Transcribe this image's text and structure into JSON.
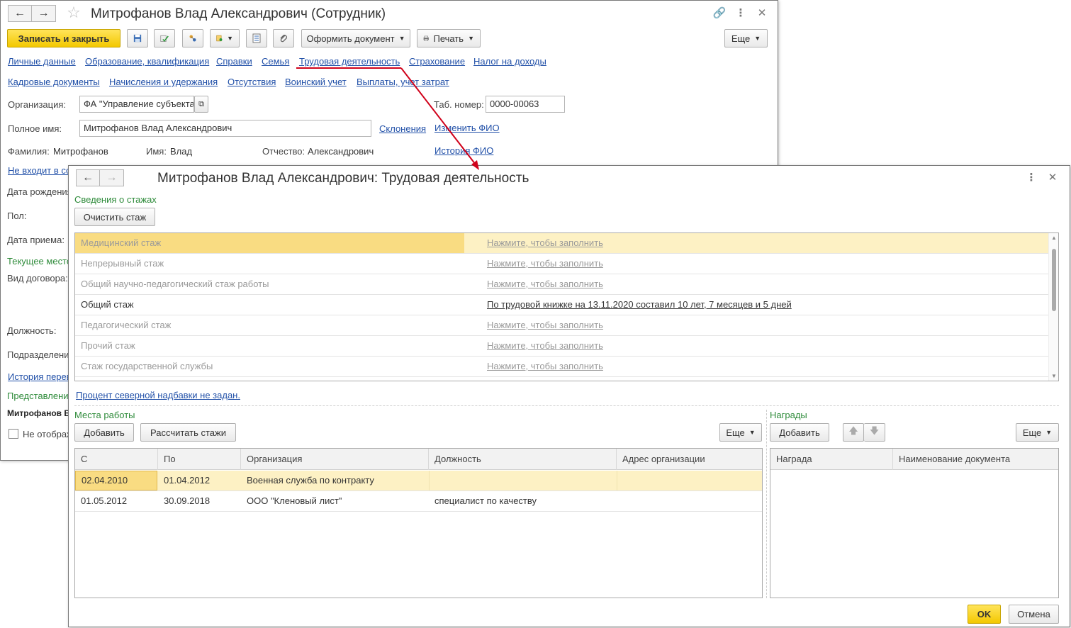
{
  "colors": {
    "accent_yellow": "#f3c800",
    "link": "#2150a8",
    "section_green": "#2e8b3a",
    "selection": "#fdf1c4",
    "arrow": "#d0021b"
  },
  "back": {
    "title": "Митрофанов Влад Александрович (Сотрудник)",
    "nav": {
      "back_icon": "arrow-left-icon",
      "forward_icon": "arrow-right-icon"
    },
    "toolbar": {
      "save_close": "Записать и закрыть",
      "create_document": "Оформить документ",
      "print": "Печать",
      "more": "Еще"
    },
    "nav_links_row1": [
      "Личные данные",
      "Образование, квалификация",
      "Справки",
      "Семья",
      "Трудовая деятельность",
      "Страхование",
      "Налог на доходы"
    ],
    "nav_links_row2": [
      "Кадровые документы",
      "Начисления и удержания",
      "Отсутствия",
      "Воинский учет",
      "Выплаты, учет затрат"
    ],
    "org_label": "Организация:",
    "org_value": "ФА \"Управление субъекта",
    "tab_label": "Таб. номер:",
    "tab_value": "0000-00063",
    "fullname_label": "Полное имя:",
    "fullname_value": "Митрофанов Влад Александрович",
    "declensions_link": "Склонения",
    "change_fio_link": "Изменить ФИО",
    "surname_label": "Фамилия:",
    "surname_value": "Митрофанов",
    "name_label": "Имя:",
    "name_value": "Влад",
    "patronymic_label": "Отчество:",
    "patronymic_value": "Александрович",
    "fio_history_link": "История ФИО",
    "not_in_link": "Не входит в со",
    "birth_label": "Дата рождения",
    "gender_label": "Пол:",
    "hire_label": "Дата приема:",
    "current_place": "Текущее место",
    "contract_label": "Вид договора:",
    "position_label": "Должность:",
    "division_label": "Подразделени",
    "transfer_history": "История перев",
    "representation": "Представление",
    "bold_name": "Митрофанов В",
    "not_show": "Не отображ"
  },
  "front": {
    "title": "Митрофанов Влад Александрович: Трудовая деятельность",
    "seniority_section": "Сведения о стажах",
    "clear_button": "Очистить стаж",
    "seniority_rows": [
      {
        "name": "Медицинский стаж",
        "value": "Нажмите, чтобы заполнить",
        "state": "selected"
      },
      {
        "name": "Непрерывный стаж",
        "value": "Нажмите, чтобы заполнить",
        "state": "empty"
      },
      {
        "name": "Общий научно-педагогический стаж работы",
        "value": "Нажмите, чтобы заполнить",
        "state": "empty"
      },
      {
        "name": "Общий стаж",
        "value": "По трудовой книжке на 13.11.2020 составил 10 лет, 7 месяцев и 5 дней",
        "state": "filled"
      },
      {
        "name": "Педагогический стаж",
        "value": "Нажмите, чтобы заполнить",
        "state": "empty"
      },
      {
        "name": "Прочий стаж",
        "value": "Нажмите, чтобы заполнить",
        "state": "empty"
      },
      {
        "name": "Стаж государственной службы",
        "value": "Нажмите, чтобы заполнить",
        "state": "empty"
      }
    ],
    "north_link": "Процент северной надбавки не задан.",
    "workplaces": {
      "section": "Места работы",
      "add": "Добавить",
      "calc": "Рассчитать стажи",
      "more": "Еще",
      "columns": [
        "С",
        "По",
        "Организация",
        "Должность",
        "Адрес организации"
      ],
      "rows": [
        [
          "02.04.2010",
          "01.04.2012",
          "Военная служба по контракту",
          "",
          ""
        ],
        [
          "01.05.2012",
          "30.09.2018",
          "ООО \"Кленовый лист\"",
          "специалист по качеству",
          ""
        ]
      ]
    },
    "awards": {
      "section": "Награды",
      "add": "Добавить",
      "more": "Еще",
      "columns": [
        "Награда",
        "Наименование документа"
      ]
    },
    "ok": "OK",
    "cancel": "Отмена"
  }
}
